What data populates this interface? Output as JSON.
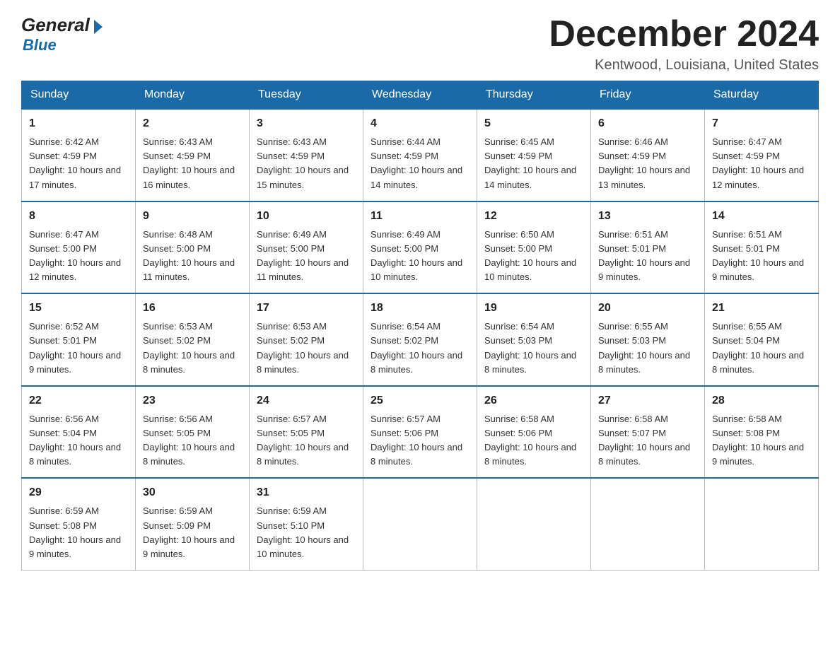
{
  "header": {
    "logo_general": "General",
    "logo_blue": "Blue",
    "month_title": "December 2024",
    "location": "Kentwood, Louisiana, United States"
  },
  "days_of_week": [
    "Sunday",
    "Monday",
    "Tuesday",
    "Wednesday",
    "Thursday",
    "Friday",
    "Saturday"
  ],
  "weeks": [
    [
      {
        "day": 1,
        "sunrise": "6:42 AM",
        "sunset": "4:59 PM",
        "daylight": "10 hours and 17 minutes."
      },
      {
        "day": 2,
        "sunrise": "6:43 AM",
        "sunset": "4:59 PM",
        "daylight": "10 hours and 16 minutes."
      },
      {
        "day": 3,
        "sunrise": "6:43 AM",
        "sunset": "4:59 PM",
        "daylight": "10 hours and 15 minutes."
      },
      {
        "day": 4,
        "sunrise": "6:44 AM",
        "sunset": "4:59 PM",
        "daylight": "10 hours and 14 minutes."
      },
      {
        "day": 5,
        "sunrise": "6:45 AM",
        "sunset": "4:59 PM",
        "daylight": "10 hours and 14 minutes."
      },
      {
        "day": 6,
        "sunrise": "6:46 AM",
        "sunset": "4:59 PM",
        "daylight": "10 hours and 13 minutes."
      },
      {
        "day": 7,
        "sunrise": "6:47 AM",
        "sunset": "4:59 PM",
        "daylight": "10 hours and 12 minutes."
      }
    ],
    [
      {
        "day": 8,
        "sunrise": "6:47 AM",
        "sunset": "5:00 PM",
        "daylight": "10 hours and 12 minutes."
      },
      {
        "day": 9,
        "sunrise": "6:48 AM",
        "sunset": "5:00 PM",
        "daylight": "10 hours and 11 minutes."
      },
      {
        "day": 10,
        "sunrise": "6:49 AM",
        "sunset": "5:00 PM",
        "daylight": "10 hours and 11 minutes."
      },
      {
        "day": 11,
        "sunrise": "6:49 AM",
        "sunset": "5:00 PM",
        "daylight": "10 hours and 10 minutes."
      },
      {
        "day": 12,
        "sunrise": "6:50 AM",
        "sunset": "5:00 PM",
        "daylight": "10 hours and 10 minutes."
      },
      {
        "day": 13,
        "sunrise": "6:51 AM",
        "sunset": "5:01 PM",
        "daylight": "10 hours and 9 minutes."
      },
      {
        "day": 14,
        "sunrise": "6:51 AM",
        "sunset": "5:01 PM",
        "daylight": "10 hours and 9 minutes."
      }
    ],
    [
      {
        "day": 15,
        "sunrise": "6:52 AM",
        "sunset": "5:01 PM",
        "daylight": "10 hours and 9 minutes."
      },
      {
        "day": 16,
        "sunrise": "6:53 AM",
        "sunset": "5:02 PM",
        "daylight": "10 hours and 8 minutes."
      },
      {
        "day": 17,
        "sunrise": "6:53 AM",
        "sunset": "5:02 PM",
        "daylight": "10 hours and 8 minutes."
      },
      {
        "day": 18,
        "sunrise": "6:54 AM",
        "sunset": "5:02 PM",
        "daylight": "10 hours and 8 minutes."
      },
      {
        "day": 19,
        "sunrise": "6:54 AM",
        "sunset": "5:03 PM",
        "daylight": "10 hours and 8 minutes."
      },
      {
        "day": 20,
        "sunrise": "6:55 AM",
        "sunset": "5:03 PM",
        "daylight": "10 hours and 8 minutes."
      },
      {
        "day": 21,
        "sunrise": "6:55 AM",
        "sunset": "5:04 PM",
        "daylight": "10 hours and 8 minutes."
      }
    ],
    [
      {
        "day": 22,
        "sunrise": "6:56 AM",
        "sunset": "5:04 PM",
        "daylight": "10 hours and 8 minutes."
      },
      {
        "day": 23,
        "sunrise": "6:56 AM",
        "sunset": "5:05 PM",
        "daylight": "10 hours and 8 minutes."
      },
      {
        "day": 24,
        "sunrise": "6:57 AM",
        "sunset": "5:05 PM",
        "daylight": "10 hours and 8 minutes."
      },
      {
        "day": 25,
        "sunrise": "6:57 AM",
        "sunset": "5:06 PM",
        "daylight": "10 hours and 8 minutes."
      },
      {
        "day": 26,
        "sunrise": "6:58 AM",
        "sunset": "5:06 PM",
        "daylight": "10 hours and 8 minutes."
      },
      {
        "day": 27,
        "sunrise": "6:58 AM",
        "sunset": "5:07 PM",
        "daylight": "10 hours and 8 minutes."
      },
      {
        "day": 28,
        "sunrise": "6:58 AM",
        "sunset": "5:08 PM",
        "daylight": "10 hours and 9 minutes."
      }
    ],
    [
      {
        "day": 29,
        "sunrise": "6:59 AM",
        "sunset": "5:08 PM",
        "daylight": "10 hours and 9 minutes."
      },
      {
        "day": 30,
        "sunrise": "6:59 AM",
        "sunset": "5:09 PM",
        "daylight": "10 hours and 9 minutes."
      },
      {
        "day": 31,
        "sunrise": "6:59 AM",
        "sunset": "5:10 PM",
        "daylight": "10 hours and 10 minutes."
      },
      null,
      null,
      null,
      null
    ]
  ]
}
